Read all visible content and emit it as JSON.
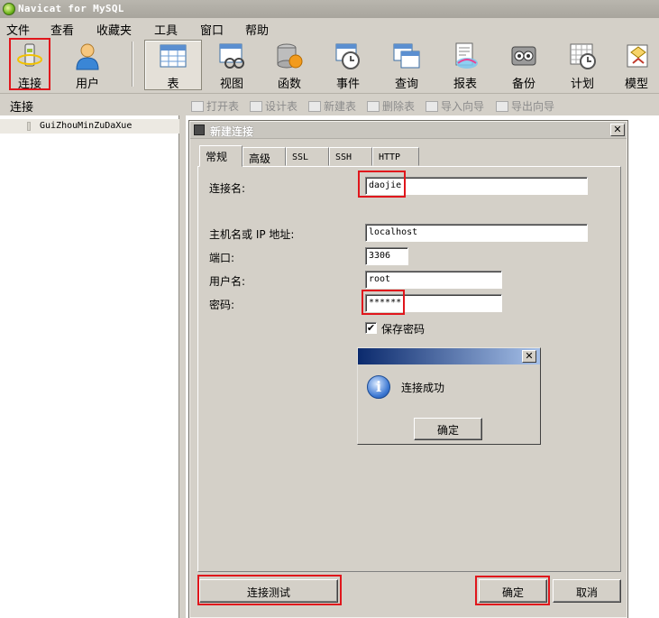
{
  "window": {
    "title": "Navicat for MySQL"
  },
  "menubar": {
    "items": [
      "文件",
      "查看",
      "收藏夹",
      "工具",
      "窗口",
      "帮助"
    ]
  },
  "toolbar": {
    "buttons": [
      {
        "label": "连接",
        "icon": "connection-icon"
      },
      {
        "label": "用户",
        "icon": "user-icon"
      },
      {
        "label": "表",
        "icon": "table-icon"
      },
      {
        "label": "视图",
        "icon": "view-icon"
      },
      {
        "label": "函数",
        "icon": "function-icon"
      },
      {
        "label": "事件",
        "icon": "event-icon"
      },
      {
        "label": "查询",
        "icon": "query-icon"
      },
      {
        "label": "报表",
        "icon": "report-icon"
      },
      {
        "label": "备份",
        "icon": "backup-icon"
      },
      {
        "label": "计划",
        "icon": "schedule-icon"
      },
      {
        "label": "模型",
        "icon": "model-icon"
      }
    ]
  },
  "subbar": {
    "section": "连接",
    "actions": [
      "打开表",
      "设计表",
      "新建表",
      "删除表",
      "导入向导",
      "导出向导"
    ]
  },
  "tree": {
    "items": [
      "GuiZhouMinZuDaXue"
    ]
  },
  "dialog": {
    "title": "新建连接",
    "close": "✕",
    "tabs": [
      "常规",
      "高级",
      "SSL",
      "SSH",
      "HTTP"
    ],
    "fields": {
      "conn_name_label": "连接名:",
      "conn_name": "daojie",
      "host_label": "主机名或 IP 地址:",
      "host": "localhost",
      "port_label": "端口:",
      "port": "3306",
      "user_label": "用户名:",
      "user": "root",
      "password_label": "密码:",
      "password": "******",
      "save_password_label": "保存密码",
      "save_password_checked": "✔"
    },
    "buttons": {
      "test": "连接测试",
      "ok": "确定",
      "cancel": "取消"
    }
  },
  "message_box": {
    "text": "连接成功",
    "ok": "确定",
    "close": "✕",
    "icon": "info-icon"
  },
  "colors": {
    "highlight_border": "#e0161c",
    "msg_title_start": "#0b2a6d",
    "msg_title_end": "#a6c0e8"
  }
}
